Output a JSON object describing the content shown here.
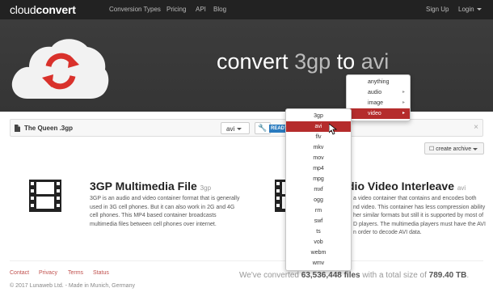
{
  "logo": {
    "light": "cloud",
    "bold": "convert"
  },
  "nav": {
    "left": [
      "Conversion Types",
      "Pricing",
      "API",
      "Blog"
    ],
    "sign_up": "Sign Up",
    "login": "Login"
  },
  "hero": {
    "prefix": "convert",
    "from": "3gp",
    "to_word": "to",
    "to": "avi"
  },
  "file": {
    "name": "The Queen .3gp",
    "target_format": "avi",
    "status": "READY",
    "close": "×"
  },
  "archive_button": "create archive",
  "info_left": {
    "title": "3GP Multimedia File",
    "ext": "3gp",
    "description": [
      "3GP is an audio and video container format that is generally",
      "used in 3G cell phones. But it can also work in 2G and 4G",
      "cell phones. This MP4 based container broadcasts",
      "multimedia files between cell phones over internet."
    ]
  },
  "info_right": {
    "title": "dio Video Interleave",
    "ext": "avi",
    "description": [
      "a video container that contains and encodes both",
      "nd video. This container has less compression ability",
      "her similar formats but still it is supported by most of",
      "D players. The multimedia players must have the AVI",
      "n order to decode AVI data."
    ]
  },
  "footer": {
    "links": [
      "Contact",
      "Privacy",
      "Terms",
      "Status"
    ],
    "copyright": "© 2017 Lunaweb Ltd. - Made in Munich, Germany",
    "stats_prefix": "We've converted",
    "files_count": "63,536,448 files",
    "stats_middle": "with a total size of",
    "total_size": "789.40 TB",
    "stats_suffix": "."
  },
  "category_menu": {
    "items": [
      "anything",
      "audio",
      "image",
      "video"
    ],
    "active": "video"
  },
  "format_menu": {
    "items": [
      "3gp",
      "avi",
      "flv",
      "mkv",
      "mov",
      "mp4",
      "mpg",
      "mxf",
      "ogg",
      "rm",
      "swf",
      "ts",
      "vob",
      "webm",
      "wmv"
    ],
    "active": "avi"
  },
  "colors": {
    "accent": "#b52c2c",
    "topbar": "#222222",
    "hero": "#3a3a3a",
    "link": "#c0504d",
    "badge": "#2a7bbf"
  }
}
